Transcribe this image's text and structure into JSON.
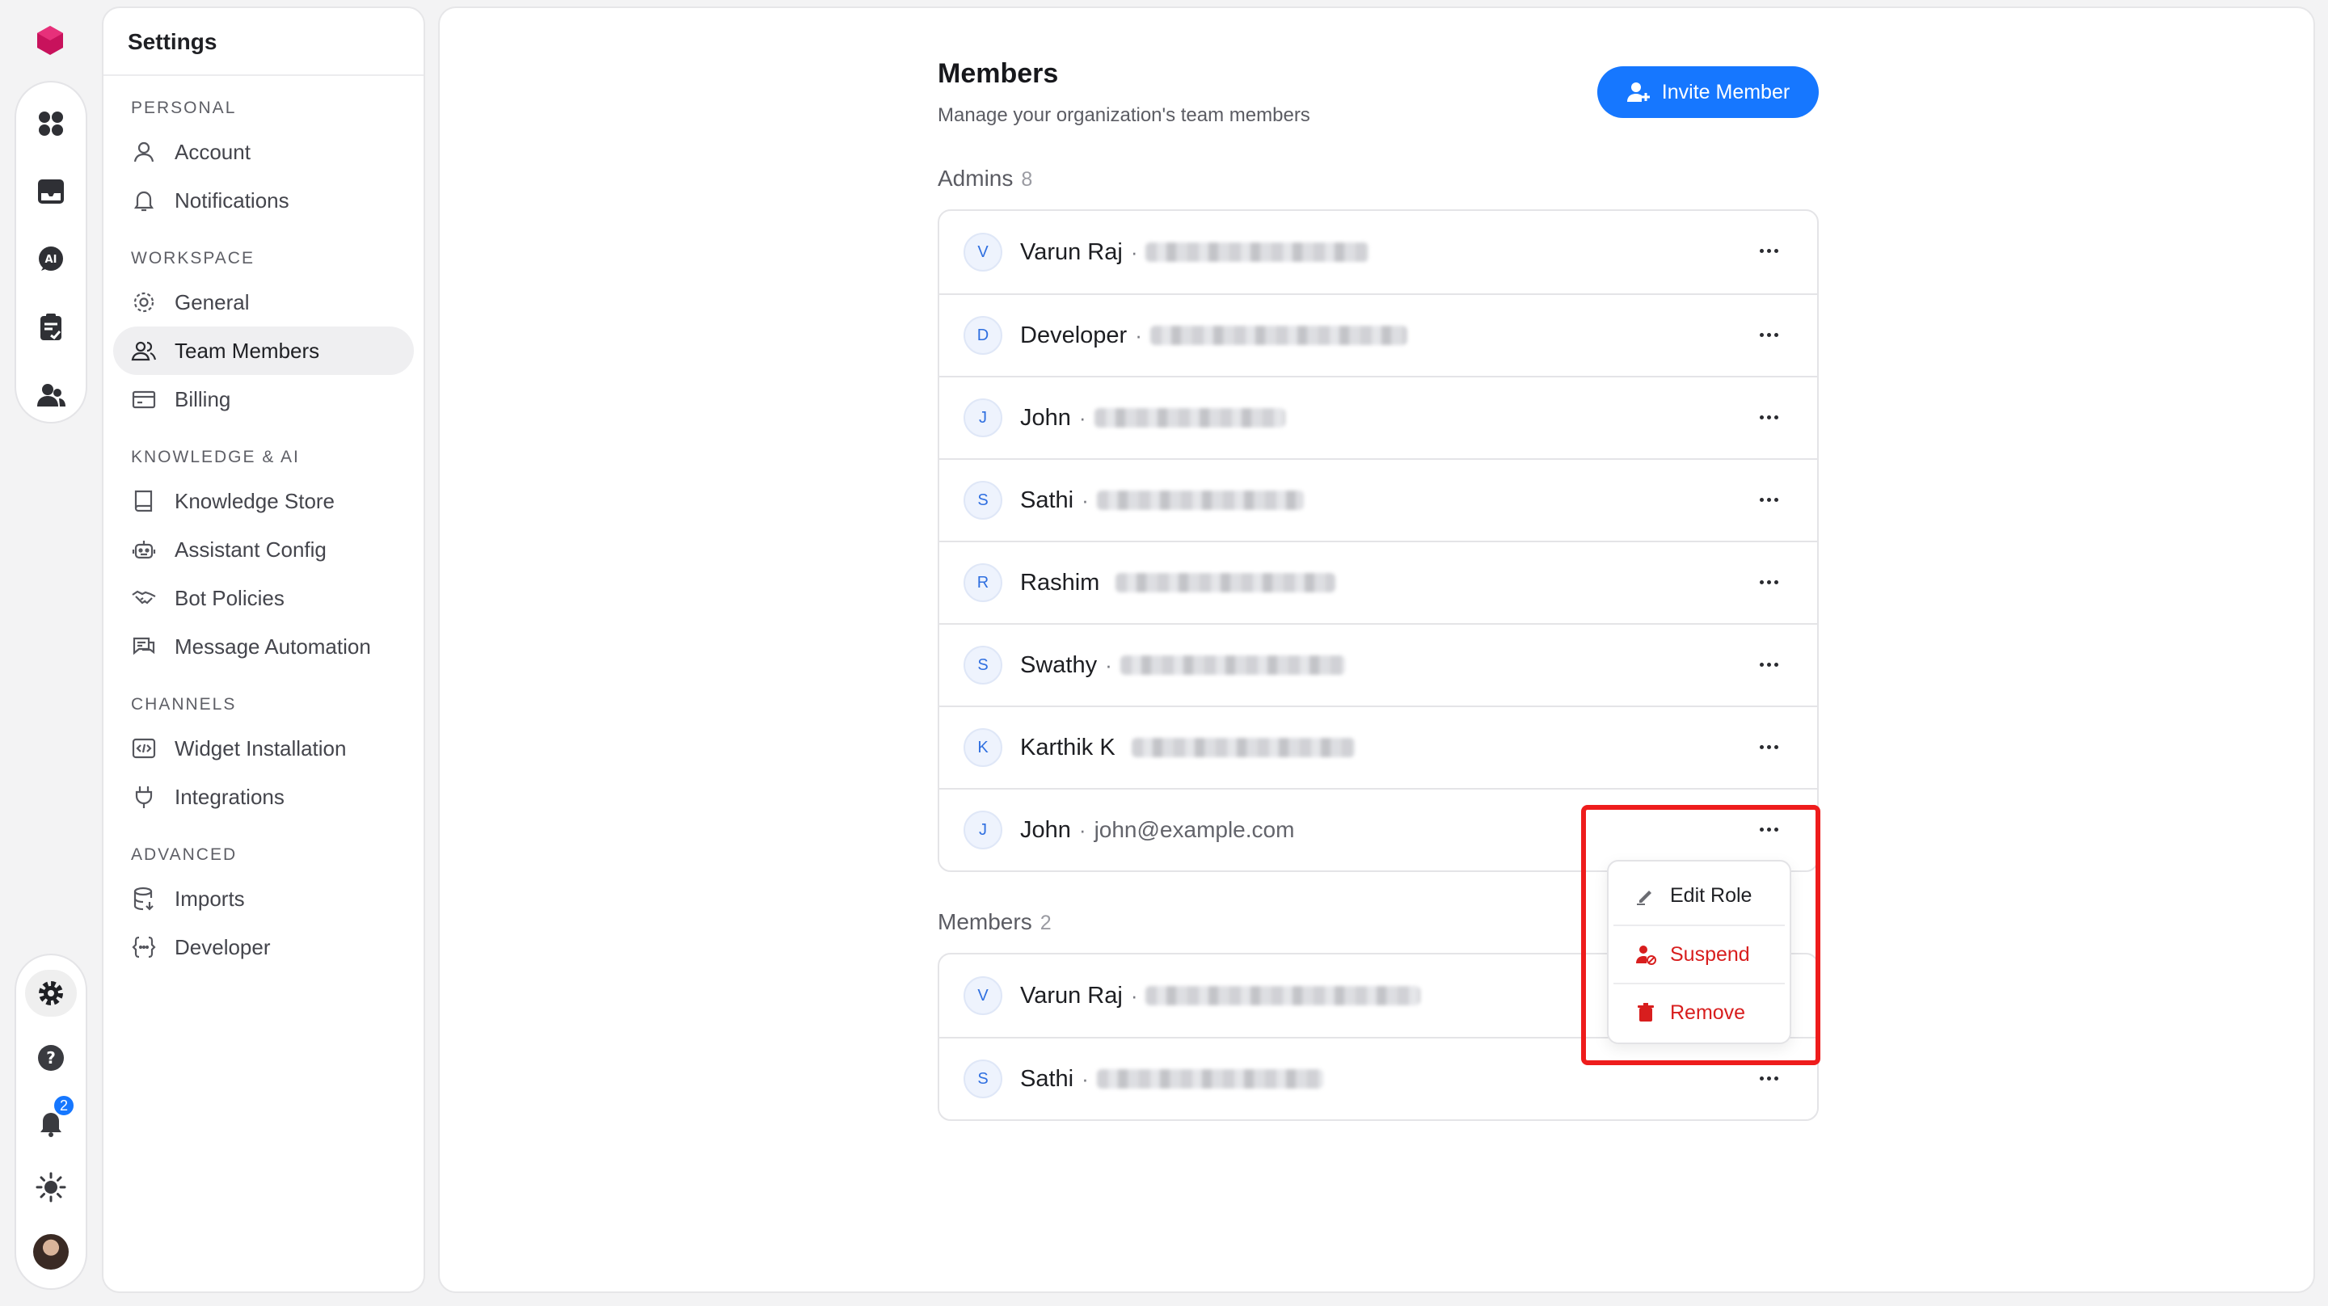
{
  "settings": {
    "title": "Settings",
    "sections": [
      {
        "label": "PERSONAL",
        "items": [
          {
            "label": "Account",
            "icon": "user-icon"
          },
          {
            "label": "Notifications",
            "icon": "bell-icon"
          }
        ]
      },
      {
        "label": "WORKSPACE",
        "items": [
          {
            "label": "General",
            "icon": "gear-icon"
          },
          {
            "label": "Team Members",
            "icon": "users-icon",
            "active": true
          },
          {
            "label": "Billing",
            "icon": "credit-card-icon"
          }
        ]
      },
      {
        "label": "KNOWLEDGE & AI",
        "items": [
          {
            "label": "Knowledge Store",
            "icon": "book-icon"
          },
          {
            "label": "Assistant Config",
            "icon": "robot-icon"
          },
          {
            "label": "Bot Policies",
            "icon": "handshake-icon"
          },
          {
            "label": "Message Automation",
            "icon": "chat-icon"
          }
        ]
      },
      {
        "label": "CHANNELS",
        "items": [
          {
            "label": "Widget Installation",
            "icon": "code-icon"
          },
          {
            "label": "Integrations",
            "icon": "plug-icon"
          }
        ]
      },
      {
        "label": "ADVANCED",
        "items": [
          {
            "label": "Imports",
            "icon": "database-icon"
          },
          {
            "label": "Developer",
            "icon": "braces-icon"
          }
        ]
      }
    ]
  },
  "rail": {
    "notification_count": "2"
  },
  "members_page": {
    "title": "Members",
    "subtitle": "Manage your organization's team members",
    "invite_label": "Invite Member",
    "admins_label": "Admins",
    "admins_count": "8",
    "members_label": "Members",
    "members_count": "2",
    "admins": [
      {
        "initial": "V",
        "name": "Varun Raj",
        "sep": "·",
        "email_blurred": true
      },
      {
        "initial": "D",
        "name": "Developer",
        "sep": "·",
        "email_blurred": true
      },
      {
        "initial": "J",
        "name": "John",
        "sep": "·",
        "email_blurred": true
      },
      {
        "initial": "S",
        "name": "Sathi",
        "sep": "·",
        "email_blurred": true
      },
      {
        "initial": "R",
        "name": "Rashim",
        "sep": "",
        "email_blurred": true
      },
      {
        "initial": "S",
        "name": "Swathy",
        "sep": "·",
        "email_blurred": true
      },
      {
        "initial": "K",
        "name": "Karthik K",
        "sep": "",
        "email_blurred": true
      },
      {
        "initial": "J",
        "name": "John",
        "sep": "·",
        "email": "john@example.com"
      }
    ],
    "members": [
      {
        "initial": "V",
        "name": "Varun Raj",
        "sep": "·",
        "email_blurred": true
      },
      {
        "initial": "S",
        "name": "Sathi",
        "sep": "·",
        "email_blurred": true
      }
    ]
  },
  "menu": {
    "edit_role": "Edit Role",
    "suspend": "Suspend",
    "remove": "Remove",
    "danger_color": "#d81e1e"
  },
  "colors": {
    "accent": "#1677ff",
    "highlight": "#ee1c1c"
  }
}
